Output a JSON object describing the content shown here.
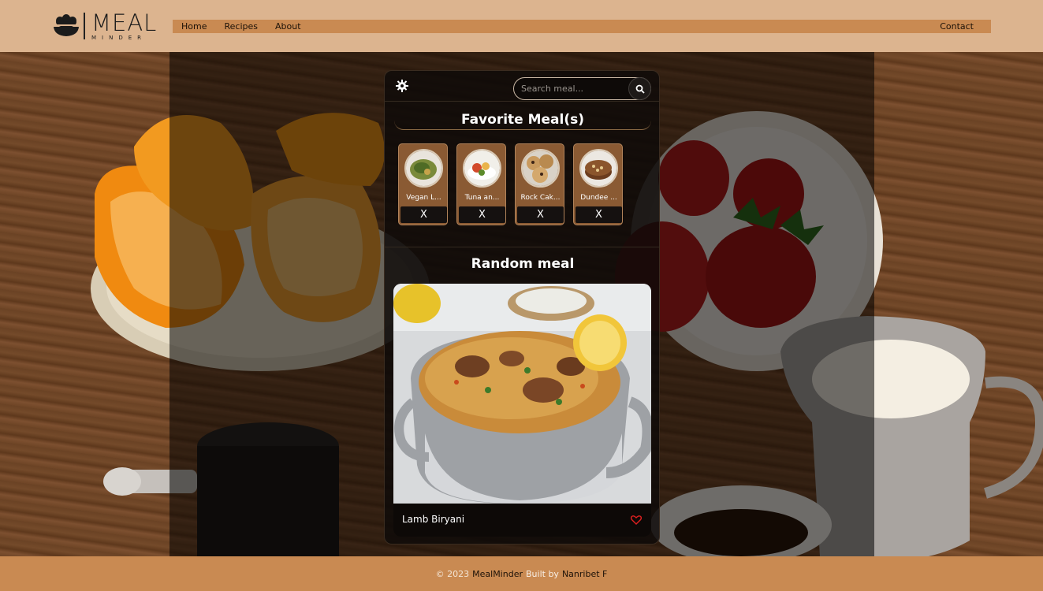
{
  "header": {
    "logo": {
      "main": "MEAL",
      "sub": "MINDER"
    },
    "nav": {
      "home": "Home",
      "recipes": "Recipes",
      "about": "About",
      "contact": "Contact"
    }
  },
  "panel": {
    "settings_icon": "gear-icon",
    "search": {
      "placeholder": "Search meal...",
      "button_icon": "search-icon"
    },
    "favorites": {
      "title": "Favorite Meal(s)",
      "items": [
        {
          "name": "Vegan L...",
          "remove": "X"
        },
        {
          "name": "Tuna an...",
          "remove": "X"
        },
        {
          "name": "Rock Cak...",
          "remove": "X"
        },
        {
          "name": "Dundee ...",
          "remove": "X"
        }
      ]
    },
    "random": {
      "title": "Random meal",
      "meal_name": "Lamb Biryani",
      "like_icon": "heart-icon"
    }
  },
  "footer": {
    "copy": "© 2023",
    "brand": "MealMinder",
    "built_by": "Built by",
    "author": "Nanribet F"
  },
  "colors": {
    "header_bg": "#dcb48f",
    "nav_bg": "#c98a52",
    "footer_bg": "#c98a52",
    "panel_bg": "#0e0a08",
    "fav_card_bg": "#8a5a33",
    "heart": "#e02020"
  }
}
